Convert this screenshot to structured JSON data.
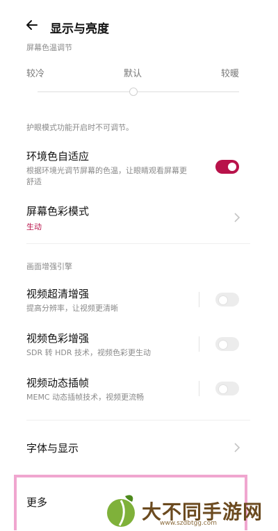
{
  "header": {
    "title": "显示与亮度"
  },
  "color_temp": {
    "section_label": "屏幕色温调节",
    "labels": [
      "较冷",
      "默认",
      "较暖"
    ],
    "level": 0.5,
    "disabled_hint": "护眼模式功能开启时不可调节。"
  },
  "ambient": {
    "title": "环境色自适应",
    "subtitle_line1": "根据环境光调节屏幕的色温，让眼睛观看屏幕更",
    "subtitle_line2": "舒适",
    "enabled": true
  },
  "color_mode": {
    "title": "屏幕色彩模式",
    "value": "生动"
  },
  "engine": {
    "section_label": "画面增强引擎",
    "items": [
      {
        "title": "视频超清增强",
        "subtitle": "提高分辨率，让视频更清晰",
        "enabled": false
      },
      {
        "title": "视频色彩增强",
        "subtitle": "SDR 转 HDR 技术，视频色彩更生动",
        "enabled": false
      },
      {
        "title": "视频动态插帧",
        "subtitle": "MEMC 动态插帧技术，视频更流畅",
        "enabled": false
      }
    ]
  },
  "font_display": {
    "title": "字体与显示"
  },
  "more": {
    "title": "更多"
  },
  "watermark": {
    "text": "大不同手游网",
    "url": "www.szdbtgg.com"
  },
  "colors": {
    "accent": "#b8124a",
    "highlight_border": "#f0a6cf"
  }
}
